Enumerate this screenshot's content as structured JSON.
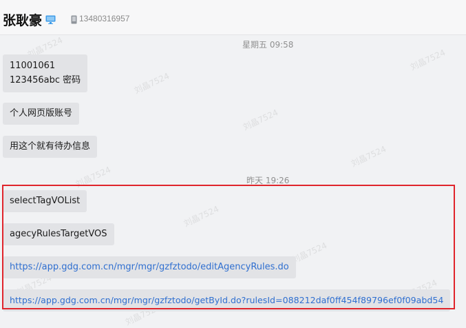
{
  "header": {
    "contact_name": "张耿豪",
    "phone": "13480316957",
    "device_icon": "monitor-icon",
    "phone_icon": "phone-icon"
  },
  "timestamps": {
    "first": "星期五 09:58",
    "second": "昨天 19:26"
  },
  "messages": [
    {
      "lines": [
        "11001061",
        "123456abc 密码"
      ]
    },
    {
      "text": "个人网页版账号"
    },
    {
      "text": "用这个就有待办信息"
    },
    {
      "text": "selectTagVOList"
    },
    {
      "text": "agecyRulesTargetVOS"
    },
    {
      "text": "https://app.gdg.com.cn/mgr/mgr/gzfztodo/editAgencyRules.do"
    },
    {
      "text": "https://app.gdg.com.cn/mgr/mgr/gzfztodo/getById.do?rulesId=088212daf0ff454f89796ef0f09abd54"
    }
  ],
  "watermark": "刘晶7524",
  "colors": {
    "highlight_border": "#e0242b",
    "link": "#2f6fd0",
    "bubble": "#e2e3e6"
  }
}
